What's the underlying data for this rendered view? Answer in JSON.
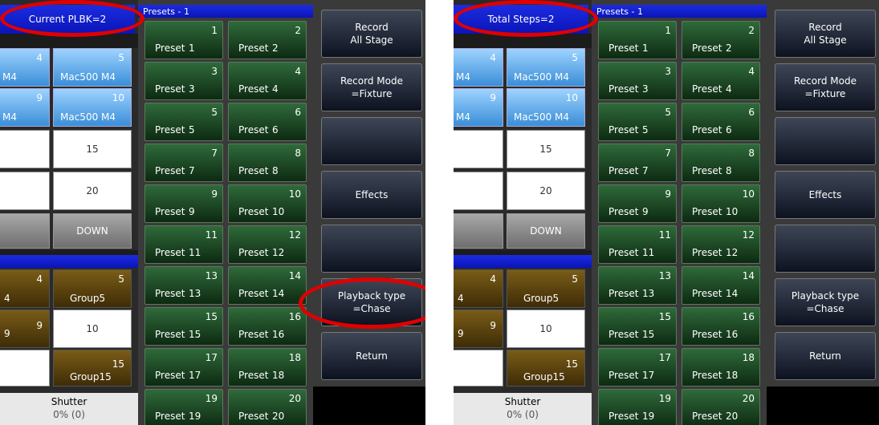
{
  "left": {
    "title": "Current PLBK=2",
    "presets_header": "Presets - 1",
    "func_buttons": [
      "Record\nAll Stage",
      "Record Mode\n=Fixture",
      "",
      "Effects",
      "",
      "Playback type\n=Chase",
      "Return"
    ],
    "fixtures": [
      {
        "partial_num": "4",
        "partial_label": "M4",
        "num": "5",
        "label": "Mac500 M4"
      },
      {
        "partial_num": "9",
        "partial_label": "M4",
        "num": "10",
        "label": "Mac500 M4"
      }
    ],
    "white_values": [
      "15",
      "20"
    ],
    "down_label": "DOWN",
    "groups": [
      {
        "partial_num": "4",
        "partial_label": "4",
        "num": "5",
        "label": "Group5"
      },
      {
        "partial_num": "9",
        "partial_label": "9",
        "white": "10"
      },
      {
        "num": "15",
        "label": "Group15"
      }
    ],
    "shutter_label": "Shutter",
    "shutter_value": "0% (0)"
  },
  "right": {
    "title": "Total Steps=2",
    "presets_header": "Presets - 1",
    "func_buttons": [
      "Record\nAll Stage",
      "Record Mode\n=Fixture",
      "",
      "Effects",
      "",
      "Playback type\n=Chase",
      "Return"
    ],
    "fixtures": [
      {
        "partial_num": "4",
        "partial_label": "M4",
        "num": "5",
        "label": "Mac500 M4"
      },
      {
        "partial_num": "9",
        "partial_label": "M4",
        "num": "10",
        "label": "Mac500 M4"
      }
    ],
    "white_values": [
      "15",
      "20"
    ],
    "down_label": "DOWN",
    "groups": [
      {
        "partial_num": "4",
        "partial_label": "4",
        "num": "5",
        "label": "Group5"
      },
      {
        "partial_num": "9",
        "partial_label": "9",
        "white": "10"
      },
      {
        "num": "15",
        "label": "Group15"
      }
    ],
    "shutter_label": "Shutter",
    "shutter_value": "0% (0)"
  },
  "presets": [
    {
      "num": "1",
      "label": "Preset",
      "idx": "1"
    },
    {
      "num": "2",
      "label": "Preset",
      "idx": "2"
    },
    {
      "num": "3",
      "label": "Preset",
      "idx": "3"
    },
    {
      "num": "4",
      "label": "Preset",
      "idx": "4"
    },
    {
      "num": "5",
      "label": "Preset",
      "idx": "5"
    },
    {
      "num": "6",
      "label": "Preset",
      "idx": "6"
    },
    {
      "num": "7",
      "label": "Preset",
      "idx": "7"
    },
    {
      "num": "8",
      "label": "Preset",
      "idx": "8"
    },
    {
      "num": "9",
      "label": "Preset",
      "idx": "9"
    },
    {
      "num": "10",
      "label": "Preset",
      "idx": "10"
    },
    {
      "num": "11",
      "label": "Preset",
      "idx": "11"
    },
    {
      "num": "12",
      "label": "Preset",
      "idx": "12"
    },
    {
      "num": "13",
      "label": "Preset",
      "idx": "13"
    },
    {
      "num": "14",
      "label": "Preset",
      "idx": "14"
    },
    {
      "num": "15",
      "label": "Preset",
      "idx": "15"
    },
    {
      "num": "16",
      "label": "Preset",
      "idx": "16"
    },
    {
      "num": "17",
      "label": "Preset",
      "idx": "17"
    },
    {
      "num": "18",
      "label": "Preset",
      "idx": "18"
    },
    {
      "num": "19",
      "label": "Preset",
      "idx": "19"
    },
    {
      "num": "20",
      "label": "Preset",
      "idx": "20"
    }
  ],
  "colors": {
    "highlight_ring": "#e00000",
    "title_blue": "#1020d0",
    "preset_green": "#1f4a26"
  }
}
